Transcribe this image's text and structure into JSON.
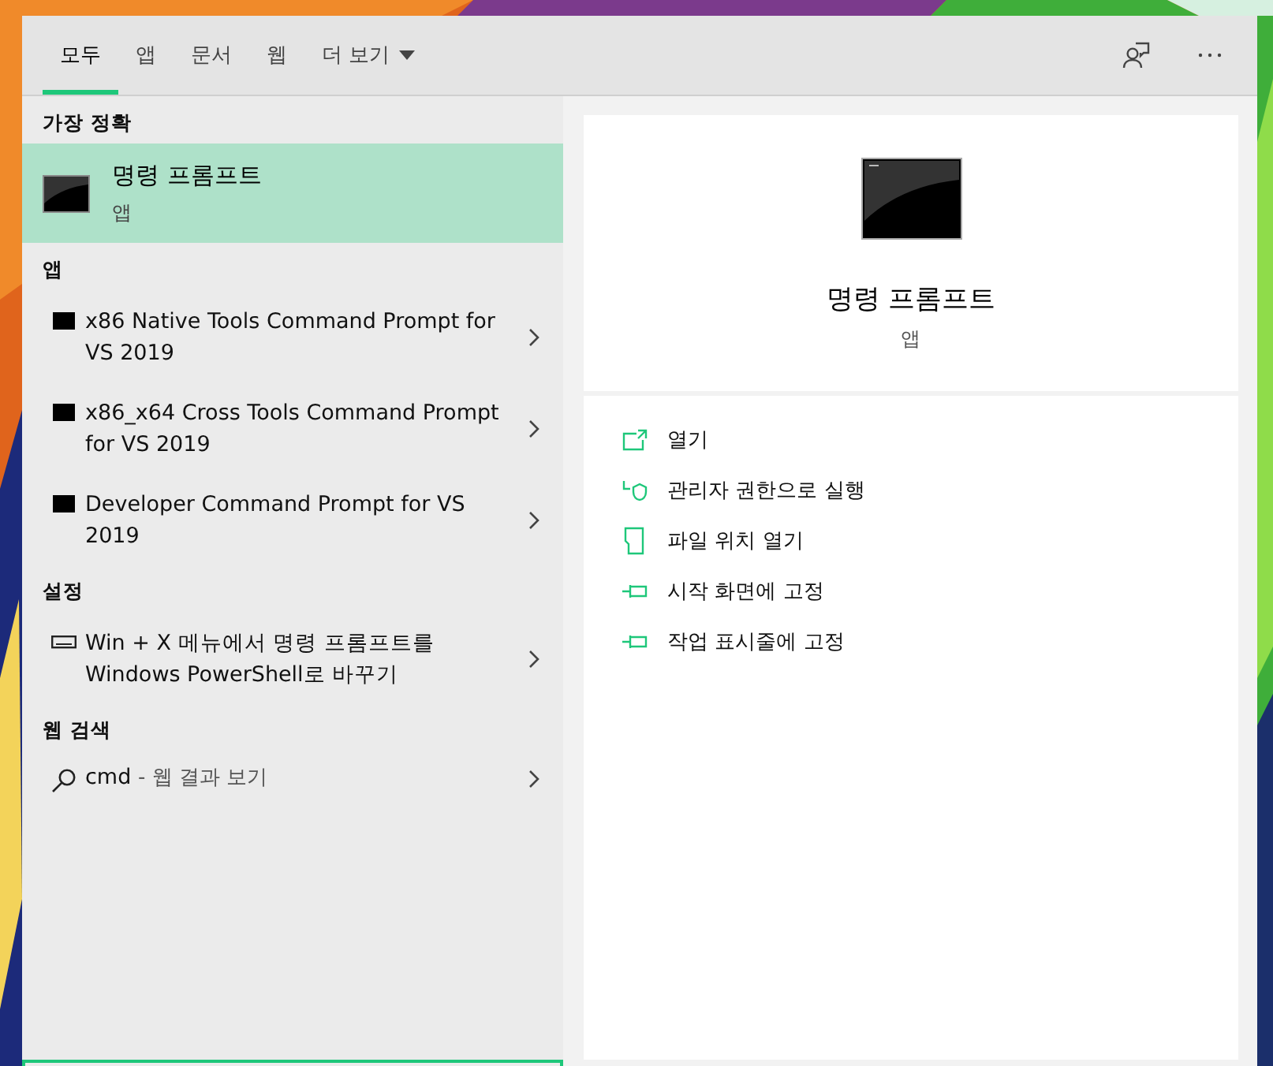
{
  "tabs": [
    {
      "label": "모두",
      "selected": true
    },
    {
      "label": "앱",
      "selected": false
    },
    {
      "label": "문서",
      "selected": false
    },
    {
      "label": "웹",
      "selected": false
    }
  ],
  "more_menu": {
    "label": "더 보기"
  },
  "best_match": {
    "heading": "가장 정확",
    "title": "명령 프롬프트",
    "subtitle": "앱",
    "selected": true
  },
  "sections": [
    {
      "heading": "앱",
      "items": [
        {
          "kind": "app",
          "text": "x86 Native Tools Command Prompt for VS 2019"
        },
        {
          "kind": "app",
          "text": "x86_x64 Cross Tools Command Prompt for VS 2019"
        },
        {
          "kind": "app",
          "text": "Developer Command Prompt for VS 2019"
        }
      ]
    },
    {
      "heading": "설정",
      "items": [
        {
          "kind": "setting",
          "text": "Win + X 메뉴에서 명령 프롬프트를 Windows PowerShell로 바꾸기"
        }
      ]
    },
    {
      "heading": "웹 검색",
      "items": [
        {
          "kind": "web",
          "text": "cmd",
          "suffix": "- 웹 결과 보기"
        }
      ]
    }
  ],
  "detail": {
    "title": "명령 프롬프트",
    "subtitle": "앱",
    "actions": [
      {
        "kind": "open",
        "label": "열기"
      },
      {
        "kind": "admin",
        "label": "관리자 권한으로 실행"
      },
      {
        "kind": "folder",
        "label": "파일 위치 열기"
      },
      {
        "kind": "pin",
        "label": "시작 화면에 고정"
      },
      {
        "kind": "pin",
        "label": "작업 표시줄에 고정"
      }
    ]
  }
}
